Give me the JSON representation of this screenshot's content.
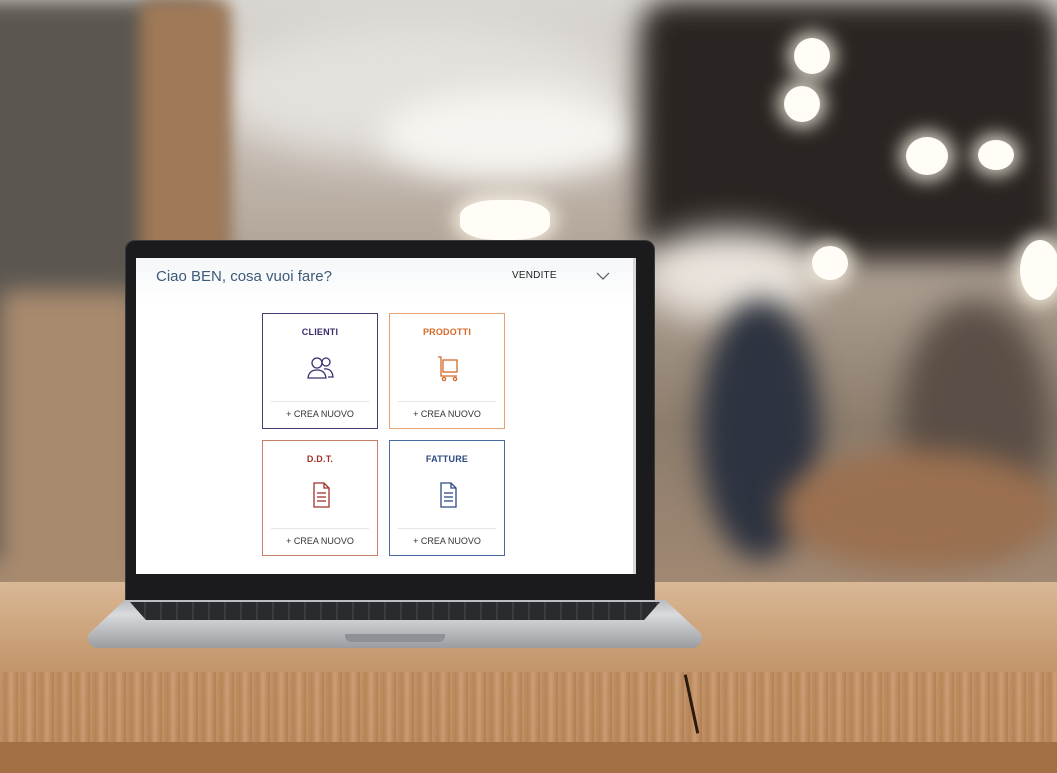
{
  "header": {
    "greeting": "Ciao BEN, cosa vuoi fare?",
    "department": {
      "selected": "VENDITE",
      "icon": "chevron-down-icon"
    }
  },
  "cards": [
    {
      "title": "CLIENTI",
      "action": "+ CREA NUOVO",
      "icon": "users-icon",
      "accent": "#3d2d70"
    },
    {
      "title": "PRODOTTI",
      "action": "+ CREA NUOVO",
      "icon": "cart-icon",
      "accent": "#d5692a"
    },
    {
      "title": "D.D.T.",
      "action": "+ CREA NUOVO",
      "icon": "document-icon",
      "accent": "#a0322a"
    },
    {
      "title": "FATTURE",
      "action": "+ CREA NUOVO",
      "icon": "invoice-icon",
      "accent": "#2d4a80"
    }
  ]
}
